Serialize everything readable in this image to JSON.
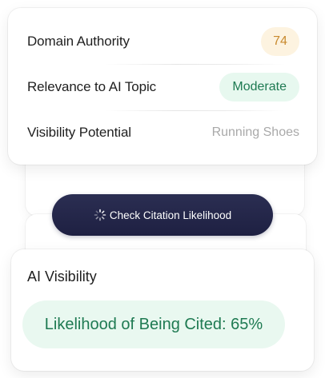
{
  "metrics": {
    "domain_authority": {
      "label": "Domain Authority",
      "value": "74"
    },
    "relevance": {
      "label": "Relevance to AI Topic",
      "value": "Moderate"
    },
    "visibility_potential": {
      "label": "Visibility Potential",
      "value": "Running Shoes"
    }
  },
  "cta": {
    "label": "Check Citation Likelihood",
    "icon": "loading-spinner-icon"
  },
  "ai_visibility": {
    "heading": "AI Visibility",
    "likelihood_text": "Likelihood of Being Cited: 65%"
  },
  "colors": {
    "score_badge_bg": "#fdf3e0",
    "score_badge_text": "#c98a2e",
    "relevance_badge_bg": "#e7f8ef",
    "relevance_badge_text": "#1e7a52",
    "cta_bg": "#23264a",
    "likelihood_bg": "#e9f8f0",
    "likelihood_text": "#1e7a52"
  }
}
